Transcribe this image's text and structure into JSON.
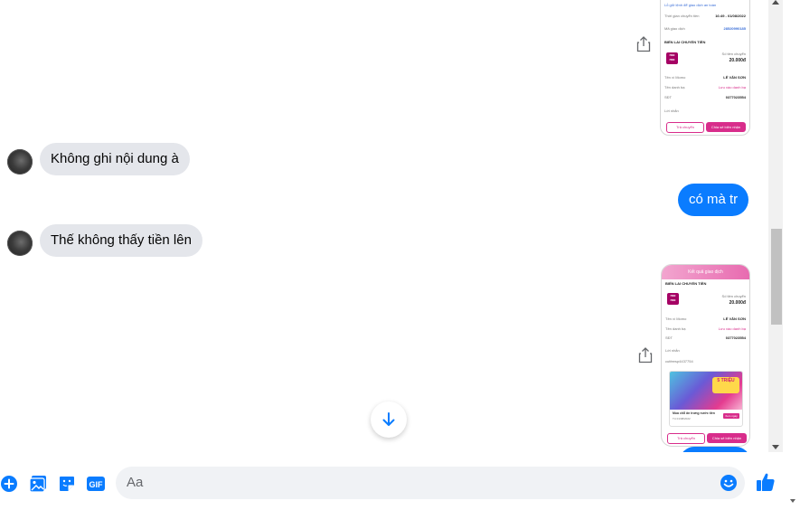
{
  "messages": [
    {
      "side": "out",
      "type": "image",
      "label": "transfer-receipt-1"
    },
    {
      "side": "in",
      "type": "text",
      "text": "Không ghi nội dung à"
    },
    {
      "side": "out",
      "type": "text",
      "text": "có mà tr"
    },
    {
      "side": "in",
      "type": "text",
      "text": "Thế không thấy tiền lên"
    },
    {
      "side": "out",
      "type": "image",
      "label": "transfer-receipt-2"
    }
  ],
  "receipt1": {
    "banner": "Lỗ giữ lệnh để giao dịch an toàn",
    "time_label": "Thời gian chuyển tiền",
    "time_value": "16:49 - 01/08/2022",
    "txid_label": "Mã giao dịch",
    "txid_value": "28520990185",
    "section": "BIẾN LAI CHUYỂN TIỀN",
    "amount_caption": "Số tiền chuyển",
    "amount": "20.000đ",
    "name_label": "Tên ví Momo",
    "name_value": "LÊ VĂN SƠN",
    "contact_label": "Tên danh bạ",
    "contact_value": "Lưu vào danh bạ",
    "phone_label": "SĐT",
    "phone_value": "0377023554",
    "note_label": "Lời nhắn",
    "btn_left": "Trả chuyển",
    "btn_right": "Chia sẻ biên nhận"
  },
  "receipt2": {
    "header": "Kết quả giao dịch",
    "section": "BIẾN LAI CHUYỂN TIỀN",
    "amount_caption": "Số tiền chuyển",
    "amount": "20.000đ",
    "name_label": "Tên ví Momo",
    "name_value": "LÊ VĂN SƠN",
    "contact_label": "Tên danh bạ",
    "contact_value": "Lưu vào danh bạ",
    "phone_label": "SĐT",
    "phone_value": "0377023554",
    "note_label": "Lời nhắn",
    "note_value": "cutfeesp4437754",
    "promo_badge": "5 TRIỆU",
    "promo_title": "Mua chỗ ăn trưng nước tiền",
    "promo_sub": "Từ 01/08/2022",
    "promo_btn": "Xem ngay",
    "btn_left": "Trả chuyển",
    "btn_right": "Chia sẻ biên nhận",
    "momo": "mo mo"
  },
  "composer": {
    "placeholder": "Aa"
  },
  "colors": {
    "outgoing": "#0a7cff",
    "incoming": "#e4e6eb",
    "icon": "#0a7cff",
    "momo": "#a50064",
    "accent_pink": "#d82d8b"
  },
  "icons": [
    "plus-circle-icon",
    "image-icon",
    "sticker-icon",
    "gif-icon",
    "emoji-icon",
    "thumbs-up-icon",
    "share-icon",
    "arrow-down-icon"
  ],
  "gif_label": "GIF"
}
